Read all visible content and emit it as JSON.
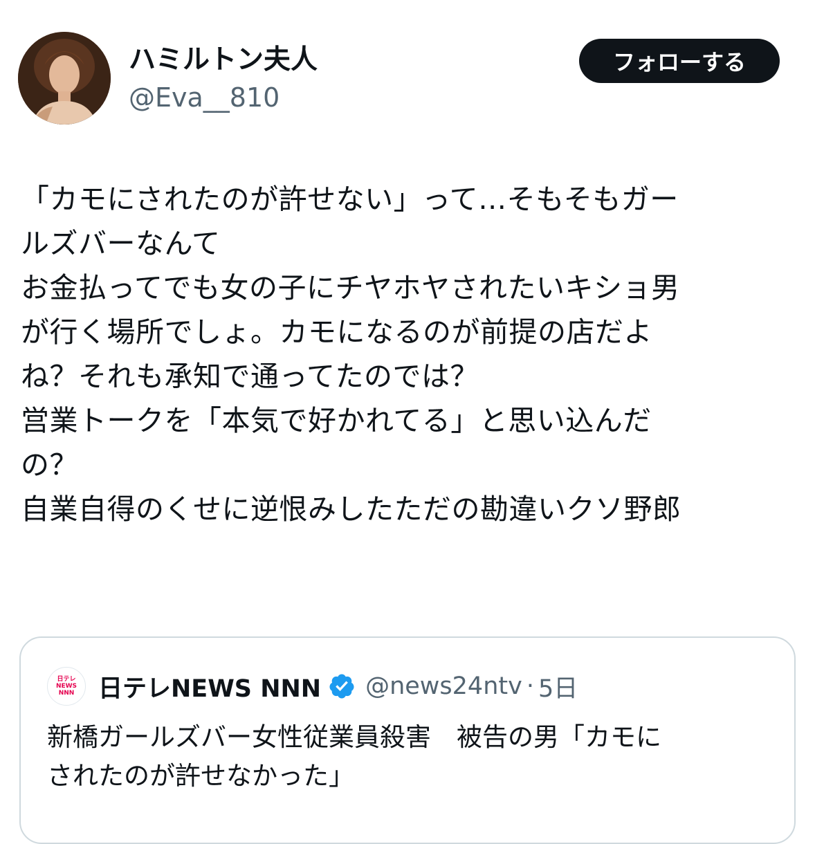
{
  "user": {
    "display_name": "ハミルトン夫人",
    "handle": "@Eva__810",
    "follow_label": "フォローする"
  },
  "tweet": {
    "lines": [
      "「カモにされたのが許せない」って…そもそもガー",
      "ルズバーなんて",
      "お金払ってでも女の子にチヤホヤされたいキショ男",
      "が行く場所でしょ。カモになるのが前提の店だよ",
      "ね？それも承知で通ってたのでは？",
      "営業トークを「本気で好かれてる」と思い込んだ",
      "の？",
      "自業自得のくせに逆恨みしたただの勘違いクソ野郎"
    ]
  },
  "quoted": {
    "logo_lines": [
      "日テレ",
      "NEWS",
      "NNN"
    ],
    "name": "日テレNEWS NNN",
    "handle": "@news24ntv",
    "separator": "·",
    "time": "5日",
    "verified_color": "#1d9bf0",
    "text_lines": [
      "新橋ガールズバー女性従業員殺害　被告の男「カモに",
      "されたのが許せなかった」"
    ]
  },
  "icons": {
    "avatar": "avatar-portrait",
    "verified": "verified-badge-icon",
    "news_logo": "news-channel-logo"
  }
}
